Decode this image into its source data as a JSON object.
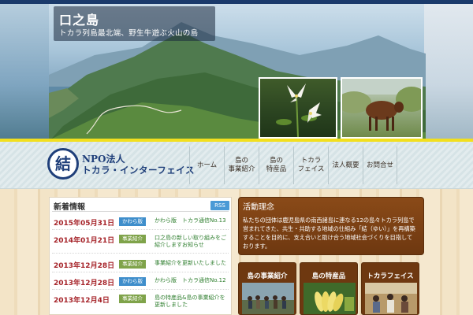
{
  "hero": {
    "title": "口之島",
    "subtitle": "トカラ列島最北端、野生牛遊ぶ火山の島"
  },
  "logo": {
    "mark": "結",
    "line1": "NPO法人",
    "line2": "トカラ・インターフェイス"
  },
  "nav": {
    "items": [
      {
        "label": "ホーム"
      },
      {
        "label": "島の\n事業紹介"
      },
      {
        "label": "島の\n特産品"
      },
      {
        "label": "トカラ\nフェイス"
      },
      {
        "label": "法人概要"
      },
      {
        "label": "お問合せ"
      }
    ]
  },
  "news": {
    "title": "新着情報",
    "rss": "RSS",
    "items": [
      {
        "date": "2015年05月31日",
        "category": "かわら版",
        "cat_color": "blue",
        "text": "かわら版　トカラ通信No.13"
      },
      {
        "date": "2014年01月21日",
        "category": "事業紹介",
        "cat_color": "green",
        "text": "口之島の新しい取り組みをご紹介しますお知らせ"
      },
      {
        "date": "2013年12月28日",
        "category": "事業紹介",
        "cat_color": "green",
        "text": "事業紹介を更新いたしました"
      },
      {
        "date": "2013年12月28日",
        "category": "かわら版",
        "cat_color": "blue",
        "text": "かわら版　トカラ通信No.12"
      },
      {
        "date": "2013年12月4日",
        "category": "事業紹介",
        "cat_color": "green",
        "text": "島の特産品&島の事業紹介を更新しました"
      }
    ]
  },
  "activity": {
    "title": "活動理念",
    "body": "私たちの団体は鹿児島県の南西諸島に連なる12の島々トカラ列島で営まれてきた、共生・共助する地域の仕組み「結（ゆい）」を再構築することを目的に、支え合いと助け合う地域社会づくりを目指しております。"
  },
  "cards": [
    {
      "label": "島の事業紹介"
    },
    {
      "label": "島の特産品"
    },
    {
      "label": "トカラフェイス"
    }
  ],
  "colors": {
    "navy": "#1f3f7a",
    "date_red": "#a6242a",
    "cat_blue": "#3f8ecb",
    "cat_green": "#7fa34a",
    "brown": "#6e3810",
    "accent_yellow": "#f2df1e"
  }
}
